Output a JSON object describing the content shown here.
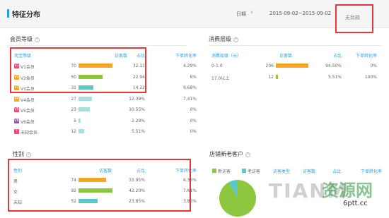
{
  "header": {
    "title": "特征分布",
    "date_label": "日期",
    "date_caret": "∨",
    "date_range": "2015-09-02~2015-09-02",
    "compare_label": "无比较"
  },
  "member_level": {
    "title": "会员等级",
    "columns": [
      "淘宝等级",
      "访客数",
      "占比",
      "下单转化率"
    ],
    "rows": [
      {
        "badge": "V1",
        "label": "V1会员",
        "visitors": "70",
        "share": "32.11",
        "conv": "4.29%",
        "bar_fraction": 1.0,
        "color": "#f5a623"
      },
      {
        "badge": "V2",
        "label": "V2会员",
        "visitors": "50",
        "share": "22.94",
        "conv": "6%",
        "bar_fraction": 0.714,
        "color": "#8dc63f"
      },
      {
        "badge": "V3",
        "label": "V3会员",
        "visitors": "31",
        "share": "14.22",
        "conv": "9.68%",
        "bar_fraction": 0.443,
        "color": "#5bc8c8"
      },
      {
        "badge": "V4",
        "label": "V4会员",
        "visitors": "27",
        "share": "12.39%",
        "conv": "7.41%",
        "bar_fraction": 0.386,
        "color": "#a8e0e0"
      },
      {
        "badge": "V5",
        "label": "V5会员",
        "visitors": "23",
        "share": "10.55%",
        "conv": "0%",
        "bar_fraction": 0.329,
        "color": "#a8e0e0"
      },
      {
        "badge": "V6",
        "label": "V6会员",
        "visitors": "5",
        "share": "2.29%",
        "conv": "0%",
        "bar_fraction": 0.071,
        "color": "#a8e0e0"
      },
      {
        "badge": "?",
        "label": "未知会员",
        "visitors": "12",
        "share": "5.51%",
        "conv": "0%",
        "bar_fraction": 0.171,
        "color": "#a8e0e0"
      }
    ],
    "badge_colors": [
      "#e94e77",
      "#f5a623",
      "#f5a623",
      "#f5a623",
      "#e94e77",
      "#9b59b6",
      "#e94e77"
    ]
  },
  "consume_level": {
    "title": "消费层级",
    "columns": [
      "消费层级（元）",
      "访客数",
      "占比",
      "下单转化率"
    ],
    "rows": [
      {
        "label": "0-1.0",
        "visitors": "206",
        "share": "94.50%",
        "conv": "0%",
        "bar_fraction": 1.0,
        "color": "#f5a623"
      },
      {
        "label": "17.0以上",
        "visitors": "12",
        "share": "5.51%",
        "conv": "100%",
        "bar_fraction": 0.06,
        "color": "#8dc63f"
      }
    ]
  },
  "gender": {
    "title": "性别",
    "columns": [
      "性别",
      "访客数",
      "占比",
      "下单转化率"
    ],
    "rows": [
      {
        "label": "男",
        "visitors": "74",
        "share": "33.95%",
        "conv": "4.35%",
        "bar_fraction": 0.804,
        "color": "#f5a623"
      },
      {
        "label": "女",
        "visitors": "92",
        "share": "42.20%",
        "conv": "7.61%",
        "bar_fraction": 1.0,
        "color": "#8dc63f"
      },
      {
        "label": "未知",
        "visitors": "52",
        "share": "23.85%",
        "conv": "3.85%",
        "bar_fraction": 0.565,
        "color": "#5bc8c8"
      }
    ]
  },
  "new_old": {
    "title": "店铺新老客户",
    "legend": [
      {
        "label": "新访客",
        "color": "#8dc63f"
      },
      {
        "label": "老访客",
        "color": "#5bc8c8"
      }
    ],
    "columns": [
      "访客类型",
      "访客数",
      "占比",
      "下单转化率"
    ],
    "pie": [
      {
        "name": "新访客",
        "value": 0.92,
        "color": "#8dc63f"
      },
      {
        "name": "老访客",
        "value": 0.08,
        "color": "#5bc8c8"
      }
    ]
  },
  "watermark": {
    "brand": "TIANM",
    "site": "资源网",
    "url": "6ptt.cc"
  }
}
